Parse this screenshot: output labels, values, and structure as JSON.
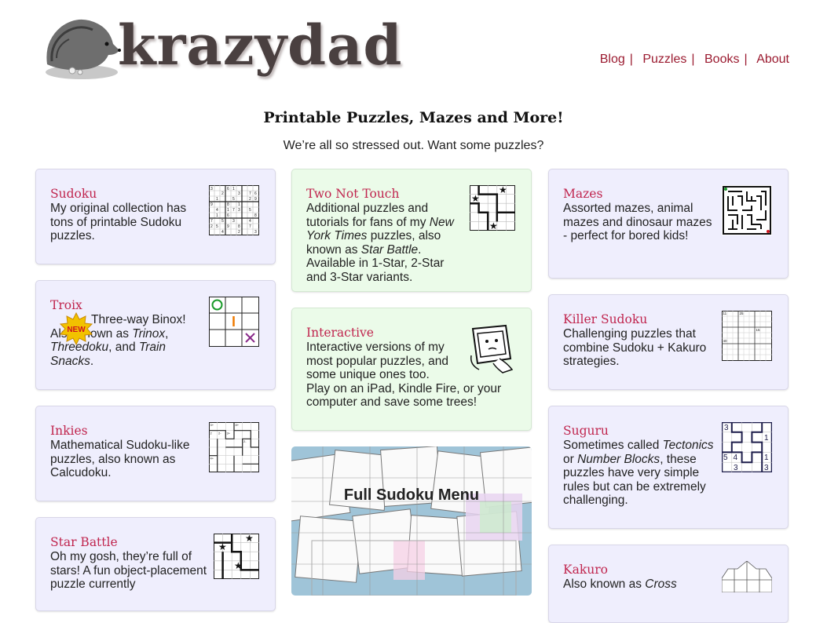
{
  "site": {
    "logo_text": "krazydad"
  },
  "nav": {
    "items": [
      "Blog",
      "Puzzles",
      "Books",
      "About"
    ]
  },
  "header": {
    "tagline": "Printable Puzzles, Mazes and More!",
    "subtitle": "We’re all so stressed out. Want some puzzles?"
  },
  "cards": {
    "sudoku": {
      "title": "Sudoku",
      "body": "My original collection has tons of printable Sudoku puzzles."
    },
    "troix": {
      "title": "Troix",
      "new_badge": "NEW",
      "body_a": "Three-way Binox! Also known as ",
      "em1": "Trinox",
      "sep1": ", ",
      "em2": "Threedoku",
      "sep2": ", and ",
      "em3": "Train Snacks",
      "end": "."
    },
    "inkies": {
      "title": "Inkies",
      "body": "Mathematical Sudoku-like puzzles, also known as Calcudoku."
    },
    "star_battle": {
      "title": "Star Battle",
      "body": "Oh my gosh, they’re full of stars! A fun object-placement puzzle currently"
    },
    "two_not_touch": {
      "title": "Two Not Touch",
      "body_a": "Additional puzzles and tutorials for fans of my ",
      "em1": "New York Times",
      "body_b": " puzzles, also known as ",
      "em2": "Star Battle",
      "body_c": ". Available in 1-Star, 2-Star and 3-Star variants."
    },
    "interactive": {
      "title": "Interactive",
      "body_a": "Interactive versions of my most popular puzzles, and some unique ones too.",
      "body_b": "Play on an iPad, Kindle Fire, or your computer and save some trees!"
    },
    "mazes": {
      "title": "Mazes",
      "body": "Assorted mazes, animal mazes and dinosaur mazes - perfect for bored kids!"
    },
    "killer_sudoku": {
      "title": "Killer Sudoku",
      "body": "Challenging puzzles that combine Sudoku + Kakuro strategies."
    },
    "suguru": {
      "title": "Suguru",
      "body_a": "Sometimes called ",
      "em1": "Tectonics",
      "body_b": " or ",
      "em2": "Number Blocks",
      "body_c": ", these puzzles have very simple rules but can be extremely challenging."
    },
    "kakuro": {
      "title": "Kakuro",
      "body_a": "Also known as ",
      "em1": "Cross"
    }
  },
  "full_menu": {
    "label": "Full Sudoku Menu"
  },
  "colors": {
    "accent": "#c0254e",
    "nav": "#9b1b30",
    "card_lavender": "#efeefd",
    "card_green": "#ebfbe9"
  }
}
